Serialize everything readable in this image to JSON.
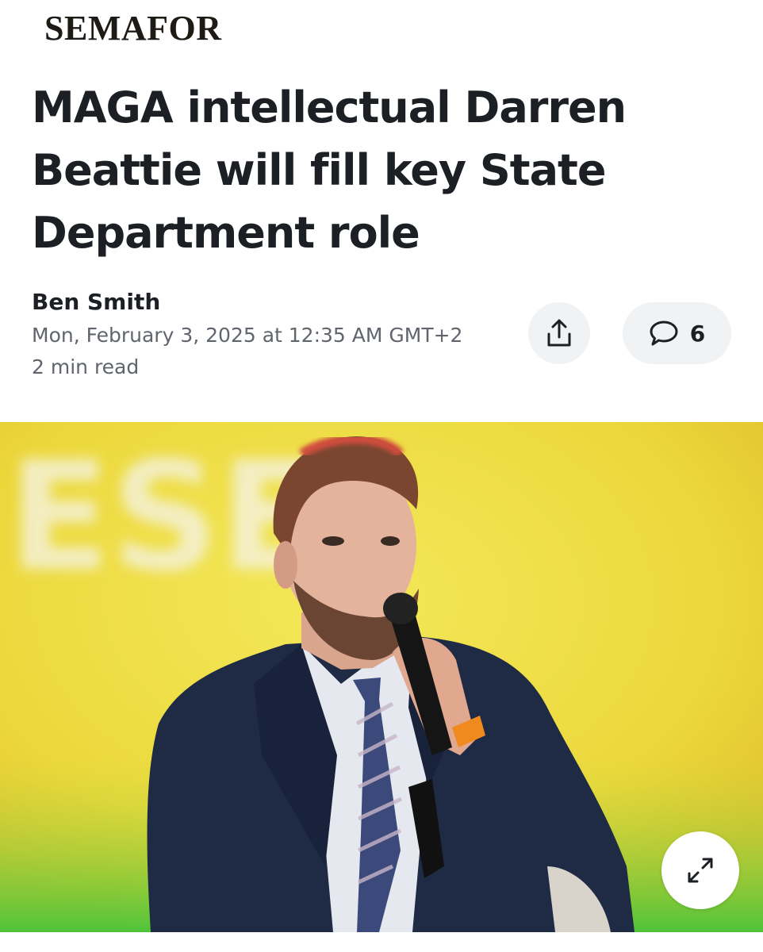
{
  "publication": {
    "logo_text": "SEMAFOR"
  },
  "article": {
    "headline": "MAGA intellectual Darren Beattie will fill key State Department role",
    "author": "Ben Smith",
    "date": "Mon, February 3, 2025 at 12:35 AM GMT+2",
    "read_time": "2 min read"
  },
  "actions": {
    "share_icon": "share-upload-icon",
    "comment_icon": "speech-bubble-icon",
    "comment_count": "6",
    "expand_icon": "expand-arrows-icon"
  },
  "photo": {
    "background_sign_text": "ESE",
    "colors": {
      "backdrop_yellow": "#eedd3c",
      "backdrop_green": "#58c63c",
      "suit": "#1f2a44"
    }
  }
}
